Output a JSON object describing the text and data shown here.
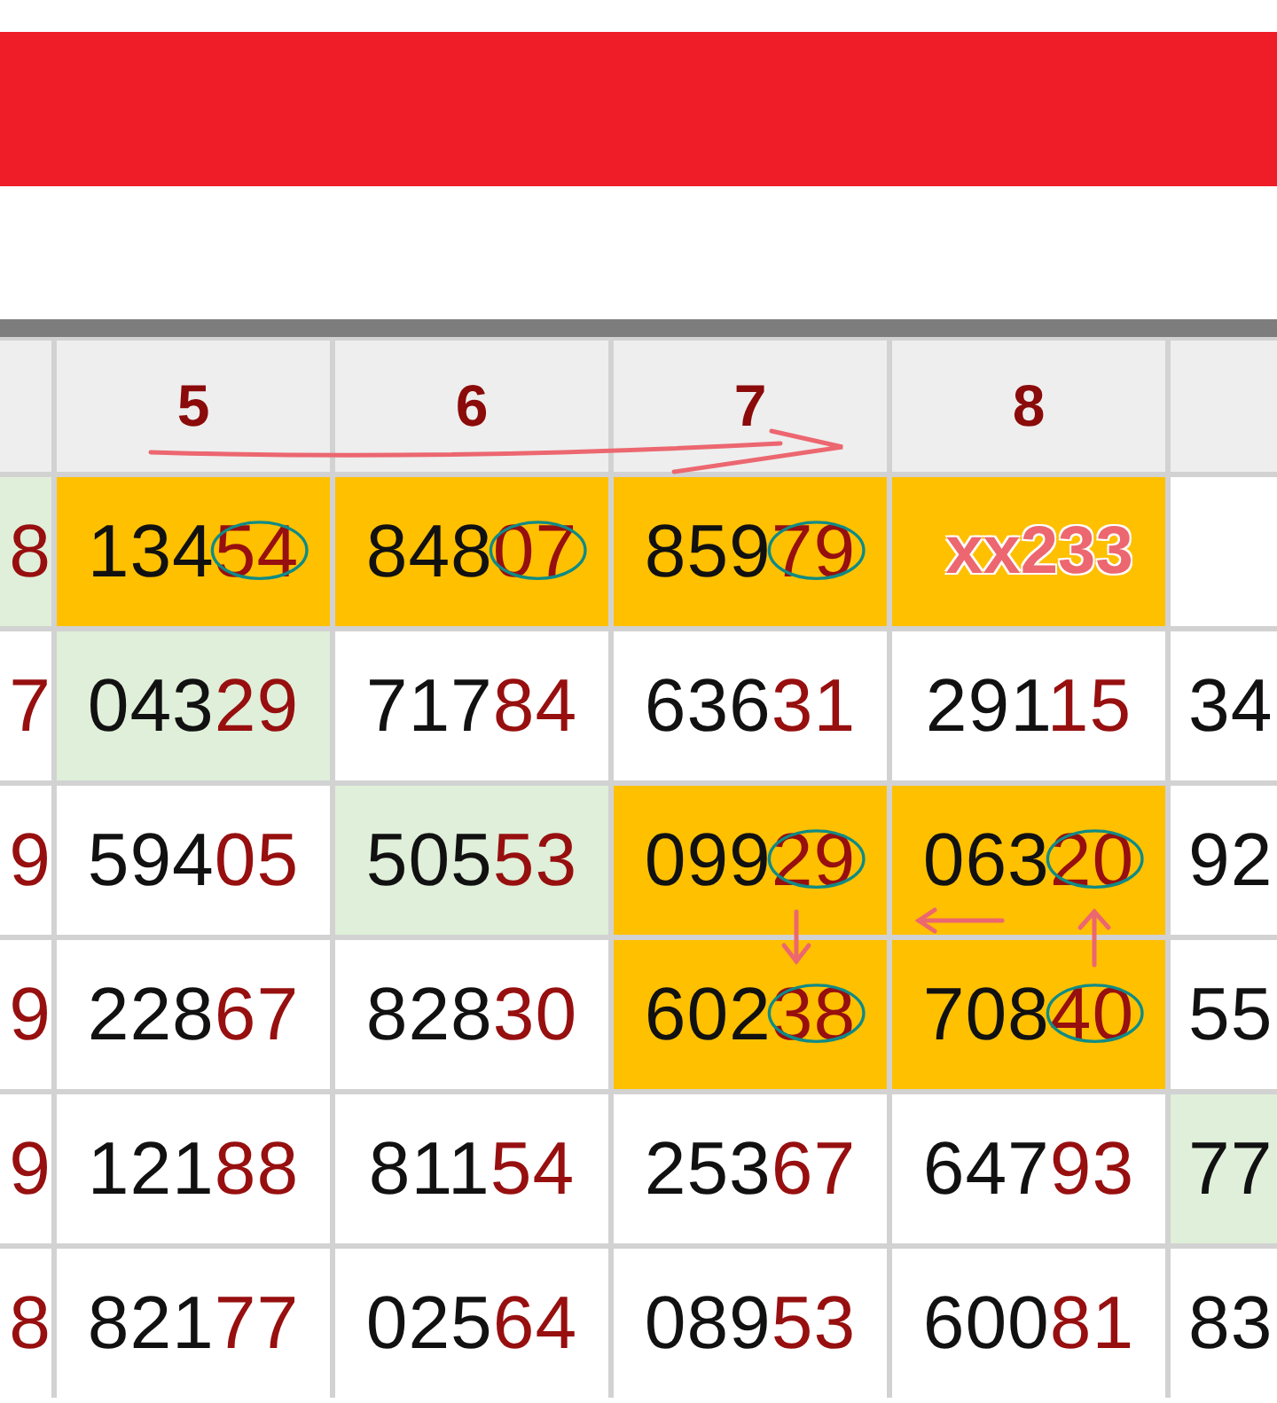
{
  "columns": [
    "5",
    "6",
    "7",
    "8"
  ],
  "rows": [
    {
      "cells": [
        {
          "kind": "match",
          "tail": "8"
        },
        {
          "kind": "hit",
          "head": "134",
          "tail": "54",
          "circled": true
        },
        {
          "kind": "hit",
          "head": "848",
          "tail": "07",
          "circled": true
        },
        {
          "kind": "hit",
          "head": "859",
          "tail": "79",
          "circled": true
        },
        {
          "kind": "note",
          "text": "xx233"
        },
        {
          "kind": "plain"
        }
      ]
    },
    {
      "cells": [
        {
          "kind": "plain",
          "tail": "7"
        },
        {
          "kind": "match",
          "head": "043",
          "tail": "29",
          "circled": false
        },
        {
          "kind": "plain",
          "head": "717",
          "tail": "84",
          "circled": false
        },
        {
          "kind": "plain",
          "head": "636",
          "tail": "31",
          "circled": false
        },
        {
          "kind": "plain",
          "head": "291",
          "tail": "15",
          "circled": false
        },
        {
          "kind": "plain",
          "head": "34"
        }
      ]
    },
    {
      "cells": [
        {
          "kind": "plain",
          "tail": "9"
        },
        {
          "kind": "plain",
          "head": "594",
          "tail": "05",
          "circled": false
        },
        {
          "kind": "match",
          "head": "505",
          "tail": "53",
          "circled": false
        },
        {
          "kind": "hit",
          "head": "099",
          "tail": "29",
          "circled": true
        },
        {
          "kind": "hit",
          "head": "063",
          "tail": "20",
          "circled": true
        },
        {
          "kind": "plain",
          "head": "92"
        }
      ]
    },
    {
      "cells": [
        {
          "kind": "plain",
          "tail": "9"
        },
        {
          "kind": "plain",
          "head": "228",
          "tail": "67",
          "circled": false
        },
        {
          "kind": "plain",
          "head": "828",
          "tail": "30",
          "circled": false
        },
        {
          "kind": "hit",
          "head": "602",
          "tail": "38",
          "circled": true
        },
        {
          "kind": "hit",
          "head": "708",
          "tail": "40",
          "circled": true
        },
        {
          "kind": "plain",
          "head": "55"
        }
      ]
    },
    {
      "cells": [
        {
          "kind": "plain",
          "tail": "9"
        },
        {
          "kind": "plain",
          "head": "121",
          "tail": "88",
          "circled": false
        },
        {
          "kind": "plain",
          "head": "811",
          "tail": "54",
          "circled": false
        },
        {
          "kind": "plain",
          "head": "253",
          "tail": "67",
          "circled": false
        },
        {
          "kind": "plain",
          "head": "647",
          "tail": "93",
          "circled": false
        },
        {
          "kind": "match",
          "head": "77"
        }
      ]
    },
    {
      "cells": [
        {
          "kind": "plain",
          "tail": "8"
        },
        {
          "kind": "plain",
          "head": "821",
          "tail": "77",
          "circled": false
        },
        {
          "kind": "plain",
          "head": "025",
          "tail": "64",
          "circled": false
        },
        {
          "kind": "plain",
          "head": "089",
          "tail": "53",
          "circled": false
        },
        {
          "kind": "plain",
          "head": "600",
          "tail": "81",
          "circled": false
        },
        {
          "kind": "plain",
          "head": "83"
        }
      ]
    }
  ]
}
